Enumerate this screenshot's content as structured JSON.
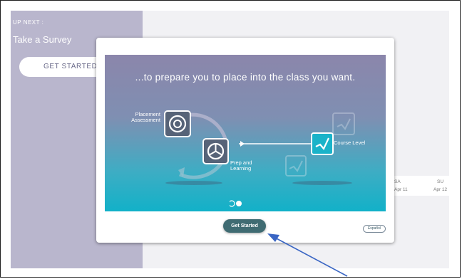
{
  "sidebar": {
    "up_next": "UP NEXT :",
    "title": "Take a Survey",
    "button": "GET STARTED"
  },
  "calendar": {
    "days": [
      "SA",
      "SU"
    ],
    "dates": [
      "Apr 11",
      "Apr 12"
    ]
  },
  "modal": {
    "headline": "...to prepare you to place into the class you want.",
    "labels": {
      "placement": "Placement Assessment",
      "prep": "Prep and Learning",
      "course": "Course Level"
    },
    "slides": {
      "total": 2,
      "active": 2
    },
    "get_started": "Get Started",
    "language": "Español"
  },
  "colors": {
    "sidebar": "#b9b6cd",
    "slide_top": "#8b86ab",
    "slide_bottom": "#12b1c8",
    "primary_button": "#3f6b72",
    "course_icon": "#1ab3c9",
    "annotation_arrow": "#3a66c4"
  }
}
